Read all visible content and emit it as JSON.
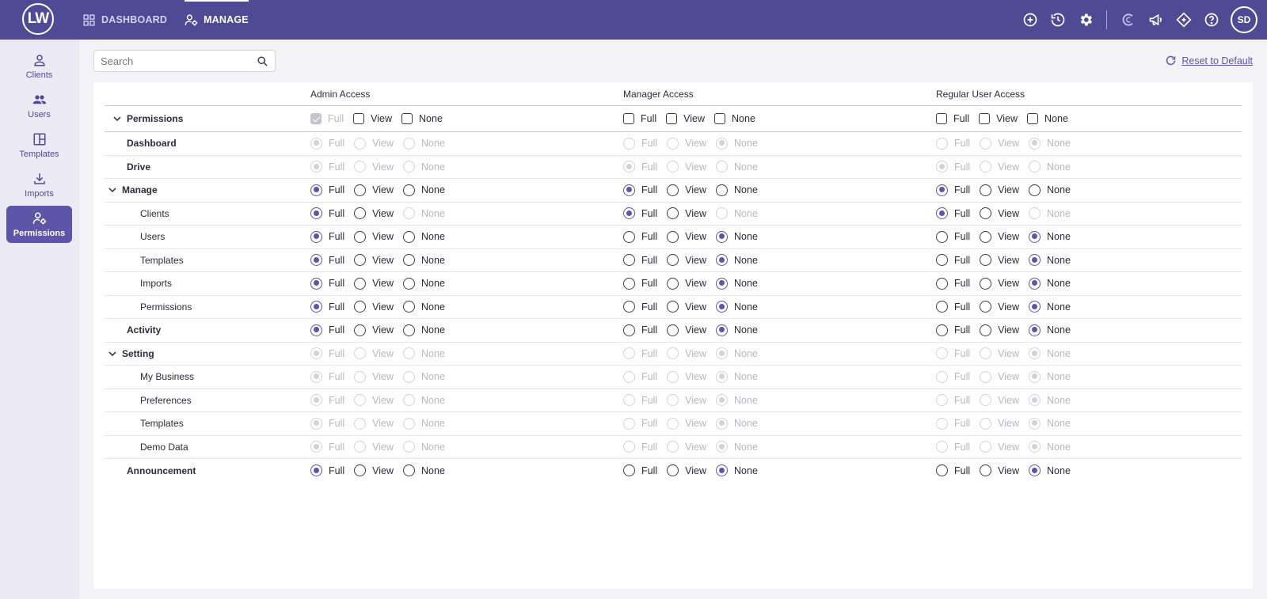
{
  "header": {
    "logo": "LW",
    "nav": [
      {
        "label": "DASHBOARD",
        "icon": "grid-icon"
      },
      {
        "label": "MANAGE",
        "icon": "user-gear-icon"
      }
    ],
    "avatar_initials": "SD",
    "icons": [
      "add-circle-icon",
      "history-icon",
      "gear-icon",
      "c-logo-icon",
      "megaphone-icon",
      "diamond-icon",
      "help-icon"
    ]
  },
  "sidebar": {
    "items": [
      {
        "label": "Clients",
        "icon": "person-icon"
      },
      {
        "label": "Users",
        "icon": "users-icon"
      },
      {
        "label": "Templates",
        "icon": "layout-icon"
      },
      {
        "label": "Imports",
        "icon": "download-icon"
      },
      {
        "label": "Permissions",
        "icon": "permissions-icon"
      }
    ]
  },
  "toolbar": {
    "search_placeholder": "Search",
    "reset_label": "Reset to Default"
  },
  "table": {
    "columns": [
      "Admin Access",
      "Manager Access",
      "Regular User Access"
    ],
    "option_labels": [
      "Full",
      "View",
      "None"
    ],
    "rows": [
      {
        "label": "Permissions",
        "level": 0,
        "bold": true,
        "chevron": true,
        "checkbox": true,
        "groups": [
          {
            "sel": 0,
            "dis": [
              0,
              0,
              0
            ],
            "allDisabled": true
          },
          {
            "sel": -1,
            "dis": [
              0,
              0,
              0
            ]
          },
          {
            "sel": -1,
            "dis": [
              0,
              0,
              0
            ]
          }
        ]
      },
      {
        "label": "Dashboard",
        "level": 1,
        "bold": true,
        "groups": [
          {
            "sel": 0,
            "dis": [
              1,
              1,
              1
            ]
          },
          {
            "sel": 2,
            "dis": [
              1,
              1,
              1
            ]
          },
          {
            "sel": 2,
            "dis": [
              1,
              1,
              1
            ]
          }
        ]
      },
      {
        "label": "Drive",
        "level": 1,
        "bold": true,
        "groups": [
          {
            "sel": 0,
            "dis": [
              1,
              1,
              1
            ]
          },
          {
            "sel": 0,
            "dis": [
              1,
              1,
              1
            ]
          },
          {
            "sel": 0,
            "dis": [
              1,
              1,
              1
            ]
          }
        ]
      },
      {
        "label": "Manage",
        "level": 1,
        "bold": true,
        "chevron": true,
        "groups": [
          {
            "sel": 0,
            "dis": [
              0,
              0,
              0
            ]
          },
          {
            "sel": 0,
            "dis": [
              0,
              0,
              0
            ]
          },
          {
            "sel": 0,
            "dis": [
              0,
              0,
              0
            ]
          }
        ]
      },
      {
        "label": "Clients",
        "level": 2,
        "groups": [
          {
            "sel": 0,
            "dis": [
              0,
              0,
              1
            ]
          },
          {
            "sel": 0,
            "dis": [
              0,
              0,
              1
            ]
          },
          {
            "sel": 0,
            "dis": [
              0,
              0,
              1
            ]
          }
        ]
      },
      {
        "label": "Users",
        "level": 2,
        "groups": [
          {
            "sel": 0,
            "dis": [
              0,
              0,
              0
            ]
          },
          {
            "sel": 2,
            "dis": [
              0,
              0,
              0
            ]
          },
          {
            "sel": 2,
            "dis": [
              0,
              0,
              0
            ]
          }
        ]
      },
      {
        "label": "Templates",
        "level": 2,
        "groups": [
          {
            "sel": 0,
            "dis": [
              0,
              0,
              0
            ]
          },
          {
            "sel": 2,
            "dis": [
              0,
              0,
              0
            ]
          },
          {
            "sel": 2,
            "dis": [
              0,
              0,
              0
            ]
          }
        ]
      },
      {
        "label": "Imports",
        "level": 2,
        "groups": [
          {
            "sel": 0,
            "dis": [
              0,
              0,
              0
            ]
          },
          {
            "sel": 2,
            "dis": [
              0,
              0,
              0
            ]
          },
          {
            "sel": 2,
            "dis": [
              0,
              0,
              0
            ]
          }
        ]
      },
      {
        "label": "Permissions",
        "level": 2,
        "groups": [
          {
            "sel": 0,
            "dis": [
              0,
              0,
              0
            ]
          },
          {
            "sel": 2,
            "dis": [
              0,
              0,
              0
            ]
          },
          {
            "sel": 2,
            "dis": [
              0,
              0,
              0
            ]
          }
        ]
      },
      {
        "label": "Activity",
        "level": 1,
        "bold": true,
        "groups": [
          {
            "sel": 0,
            "dis": [
              0,
              0,
              0
            ]
          },
          {
            "sel": 2,
            "dis": [
              0,
              0,
              0
            ]
          },
          {
            "sel": 2,
            "dis": [
              0,
              0,
              0
            ]
          }
        ]
      },
      {
        "label": "Setting",
        "level": 1,
        "bold": true,
        "chevron": true,
        "groups": [
          {
            "sel": 0,
            "dis": [
              1,
              1,
              1
            ]
          },
          {
            "sel": 2,
            "dis": [
              1,
              1,
              1
            ]
          },
          {
            "sel": 2,
            "dis": [
              1,
              1,
              1
            ]
          }
        ]
      },
      {
        "label": "My Business",
        "level": 2,
        "groups": [
          {
            "sel": 0,
            "dis": [
              1,
              1,
              1
            ]
          },
          {
            "sel": 2,
            "dis": [
              1,
              1,
              1
            ]
          },
          {
            "sel": 2,
            "dis": [
              1,
              1,
              1
            ]
          }
        ]
      },
      {
        "label": "Preferences",
        "level": 2,
        "groups": [
          {
            "sel": 0,
            "dis": [
              1,
              1,
              1
            ]
          },
          {
            "sel": 2,
            "dis": [
              1,
              1,
              1
            ]
          },
          {
            "sel": 2,
            "dis": [
              1,
              1,
              1
            ]
          }
        ]
      },
      {
        "label": "Templates",
        "level": 2,
        "groups": [
          {
            "sel": 0,
            "dis": [
              1,
              1,
              1
            ]
          },
          {
            "sel": 2,
            "dis": [
              1,
              1,
              1
            ]
          },
          {
            "sel": 2,
            "dis": [
              1,
              1,
              1
            ]
          }
        ]
      },
      {
        "label": "Demo Data",
        "level": 2,
        "groups": [
          {
            "sel": 0,
            "dis": [
              1,
              1,
              1
            ]
          },
          {
            "sel": 2,
            "dis": [
              1,
              1,
              1
            ]
          },
          {
            "sel": 2,
            "dis": [
              1,
              1,
              1
            ]
          }
        ]
      },
      {
        "label": "Announcement",
        "level": 1,
        "bold": true,
        "groups": [
          {
            "sel": 0,
            "dis": [
              0,
              0,
              0
            ]
          },
          {
            "sel": 2,
            "dis": [
              0,
              0,
              0
            ]
          },
          {
            "sel": 2,
            "dis": [
              0,
              0,
              0
            ]
          }
        ]
      }
    ]
  },
  "colors": {
    "primary": "#4f4a94",
    "accent": "#5d56a8",
    "disabled": "#b7b7c2"
  }
}
